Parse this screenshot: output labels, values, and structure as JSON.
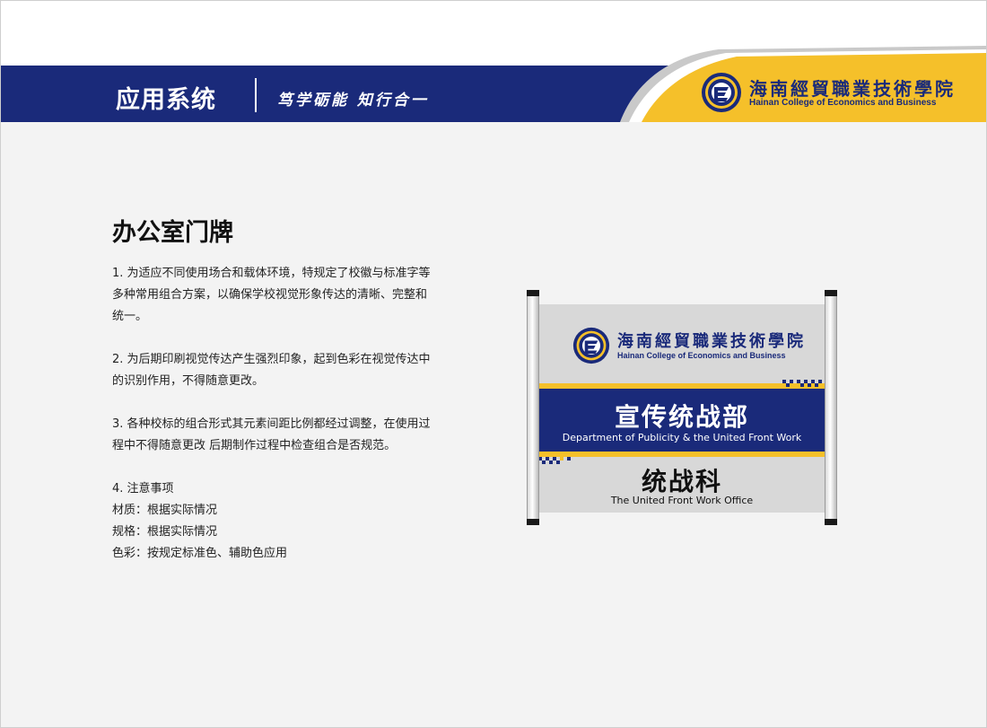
{
  "header": {
    "system_title": "应用系统",
    "slogan": "笃学砺能 知行合一",
    "logo_cn": "海南經貿職業技術學院",
    "logo_en": "Hainan College of Economics and Business"
  },
  "content": {
    "heading": "办公室门牌",
    "paragraphs": [
      "1. 为适应不同使用场合和载体环境，特规定了校徽与标准字等多种常用组合方案，以确保学校视觉形象传达的清晰、完整和统一。",
      "2. 为后期印刷视觉传达产生强烈印象，起到色彩在视觉传达中的识别作用，不得随意更改。",
      "3. 各种校标的组合形式其元素间距比例都经过调整，在使用过程中不得随意更改 后期制作过程中检查组合是否规范。"
    ],
    "notes_title": "4. 注意事项",
    "notes": [
      "材质：根据实际情况",
      "规格：根据实际情况",
      "色彩：按规定标准色、辅助色应用"
    ]
  },
  "sign": {
    "logo_cn": "海南經貿職業技術學院",
    "logo_en": "Hainan College of Economics and Business",
    "dept_cn": "宣传统战部",
    "dept_en": "Department of Publicity & the United Front Work",
    "office_cn": "统战科",
    "office_en": "The United Front Work Office"
  },
  "colors": {
    "brand_blue": "#1a2a7a",
    "brand_gold": "#f5c02a",
    "sign_gray": "#d8d8d8"
  }
}
